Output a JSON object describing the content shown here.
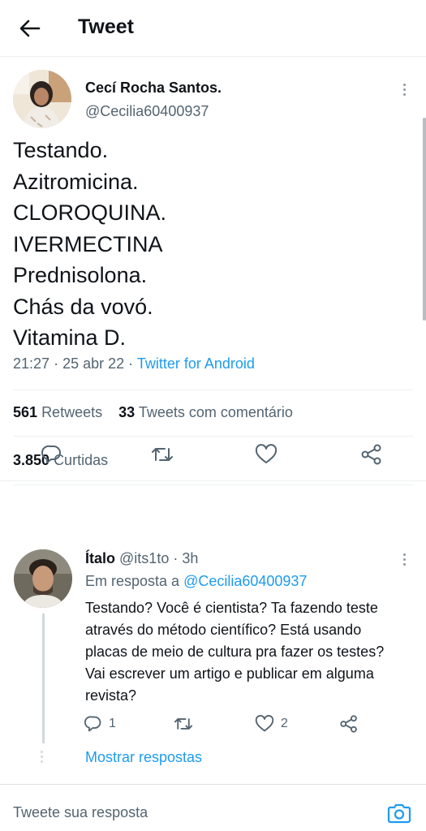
{
  "header": {
    "title": "Tweet",
    "back_icon": "arrow-left-icon"
  },
  "tweet": {
    "author_name": "Cecí Rocha Santos.",
    "author_handle": "@Cecilia60400937",
    "lines": [
      "Testando.",
      "Azitromicina.",
      "CLOROQUINA.",
      "IVERMECTINA",
      "Prednisolona.",
      "Chás da vovó.",
      "Vitamina D."
    ],
    "time": "21:27",
    "date": "25 abr 22",
    "separator": "·",
    "source": "Twitter for Android",
    "retweets_count": "561",
    "retweets_label": "Retweets",
    "quotes_count": "33",
    "quotes_label": "Tweets com comentário",
    "likes_count": "3.850",
    "likes_label": "Curtidas"
  },
  "reply": {
    "name": "Ítalo",
    "handle": "@its1to",
    "dot": "·",
    "age": "3h",
    "in_reply_prefix": "Em resposta a",
    "in_reply_handle": "@Cecilia60400937",
    "lines": [
      "Testando? Você é cientista? Ta fazendo teste",
      "através do método científico? Está usando",
      "placas de meio de cultura pra fazer os testes?",
      "Vai escrever um artigo e publicar em alguma",
      "revista?"
    ],
    "reply_count": "1",
    "like_count": "2",
    "show_replies": "Mostrar respostas"
  },
  "composer": {
    "placeholder": "Tweete sua resposta",
    "camera_icon": "camera-icon"
  },
  "colors": {
    "accent": "#1d9bf0",
    "text": "#0f1419",
    "muted": "#536471",
    "divider": "#eceff1"
  }
}
